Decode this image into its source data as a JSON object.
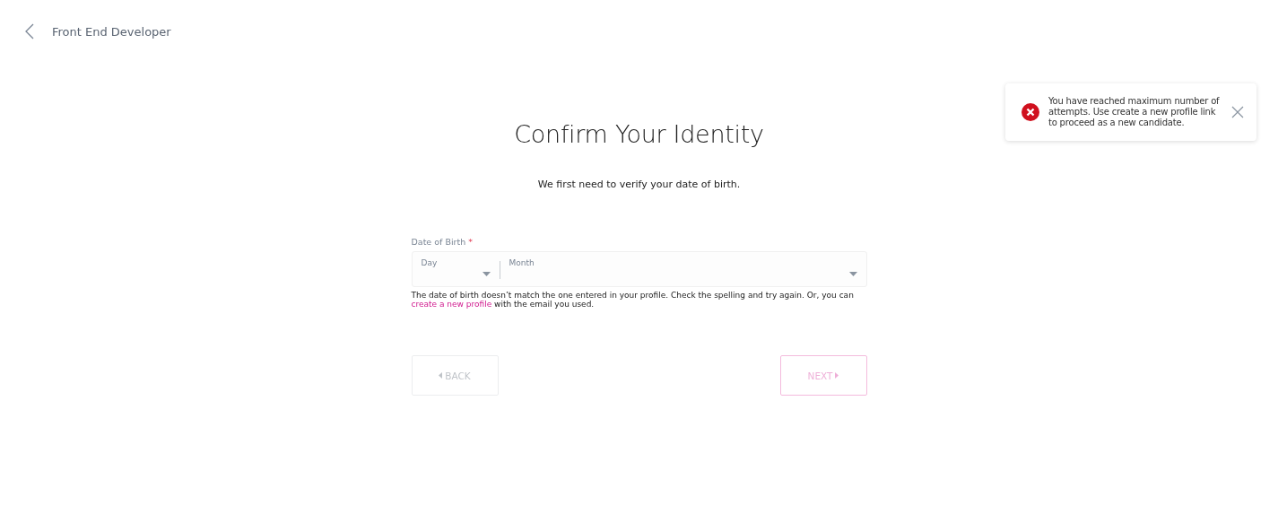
{
  "header": {
    "title": "Front End Developer"
  },
  "toast": {
    "message": "You have reached maximum number of attempts. Use create a new profile link to proceed as a new candidate."
  },
  "page": {
    "title": "Confirm Your Identity",
    "subtitle": "We first need to verify your date of birth."
  },
  "form": {
    "label": "Date of Birth",
    "required_mark": "*",
    "selects": [
      {
        "placeholder": "Day"
      },
      {
        "placeholder": "Month"
      }
    ],
    "error": {
      "before": "The date of birth doesn’t match the one entered in your profile. Check the spelling and try again. Or, you can ",
      "link": "create a new profile",
      "after": " with the email you used."
    }
  },
  "buttons": [
    {
      "kind": "back",
      "label": "BACK",
      "disabled": true
    },
    {
      "kind": "next",
      "label": "NEXT",
      "disabled": true
    }
  ]
}
